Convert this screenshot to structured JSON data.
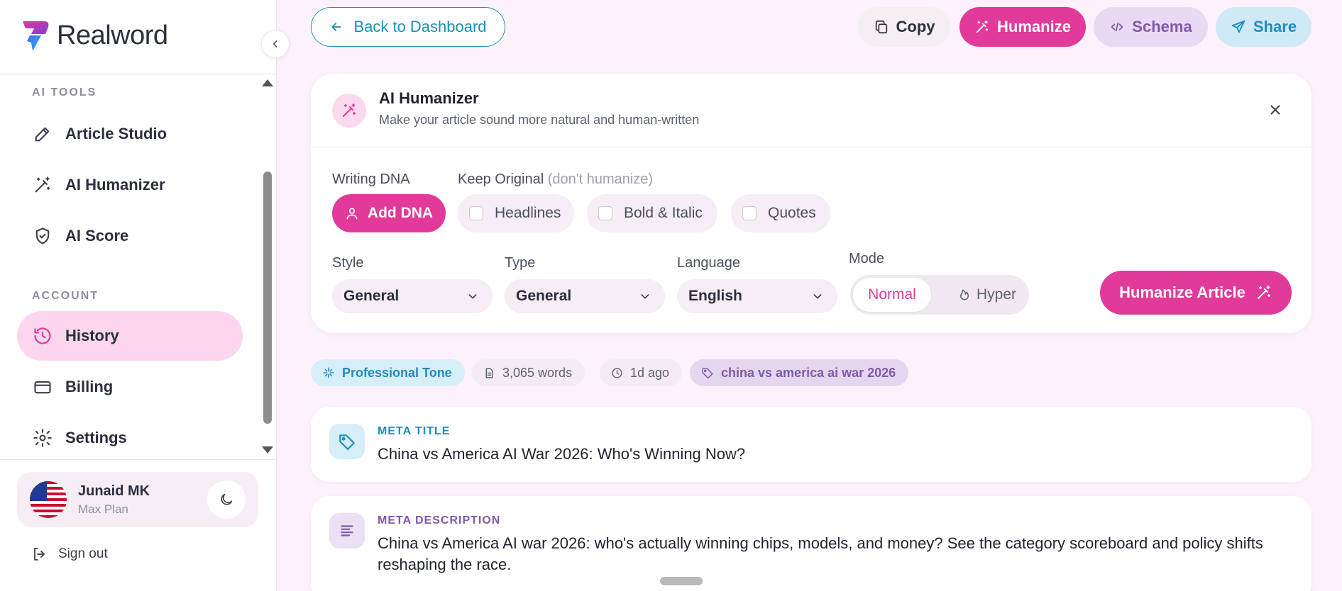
{
  "app": {
    "name": "Realword"
  },
  "sidebar": {
    "sections": [
      {
        "title": "AI TOOLS",
        "items": [
          {
            "label": "Article Studio",
            "icon": "pencil-icon"
          },
          {
            "label": "AI Humanizer",
            "icon": "magic-wand-icon"
          },
          {
            "label": "AI Score",
            "icon": "shield-check-icon"
          }
        ]
      },
      {
        "title": "ACCOUNT",
        "items": [
          {
            "label": "History",
            "icon": "history-icon",
            "active": true
          },
          {
            "label": "Billing",
            "icon": "credit-card-icon"
          },
          {
            "label": "Settings",
            "icon": "gear-icon"
          }
        ]
      }
    ],
    "user": {
      "name": "Junaid MK",
      "plan": "Max Plan"
    },
    "signout_label": "Sign out"
  },
  "toolbar": {
    "back_label": "Back to Dashboard",
    "copy_label": "Copy",
    "humanize_label": "Humanize",
    "schema_label": "Schema",
    "share_label": "Share"
  },
  "humanizer": {
    "title": "AI Humanizer",
    "subtitle": "Make your article sound more natural and human-written",
    "writing_dna_label": "Writing DNA",
    "add_dna_label": "Add DNA",
    "keep_original_label": "Keep Original",
    "keep_original_hint": "(don't humanize)",
    "keep_options": [
      "Headlines",
      "Bold & Italic",
      "Quotes"
    ],
    "style": {
      "label": "Style",
      "value": "General"
    },
    "type": {
      "label": "Type",
      "value": "General"
    },
    "language": {
      "label": "Language",
      "value": "English"
    },
    "mode": {
      "label": "Mode",
      "options": [
        "Normal",
        "Hyper"
      ],
      "selected": "Normal"
    },
    "submit_label": "Humanize Article"
  },
  "tags": {
    "tone": "Professional Tone",
    "words": "3,065 words",
    "time": "1d ago",
    "keyword": "china vs america ai war 2026"
  },
  "meta": {
    "title_label": "META TITLE",
    "title_value": "China vs America AI War 2026: Who's Winning Now?",
    "description_label": "META DESCRIPTION",
    "description_value": "China vs America AI war 2026: who's actually winning chips, models, and money? See the category scoreboard and policy shifts reshaping the race."
  },
  "colors": {
    "accent_pink": "#e23a9a",
    "accent_blue": "#1f8cbd",
    "accent_purple": "#7e5aa8",
    "background": "#fdf2fb"
  }
}
